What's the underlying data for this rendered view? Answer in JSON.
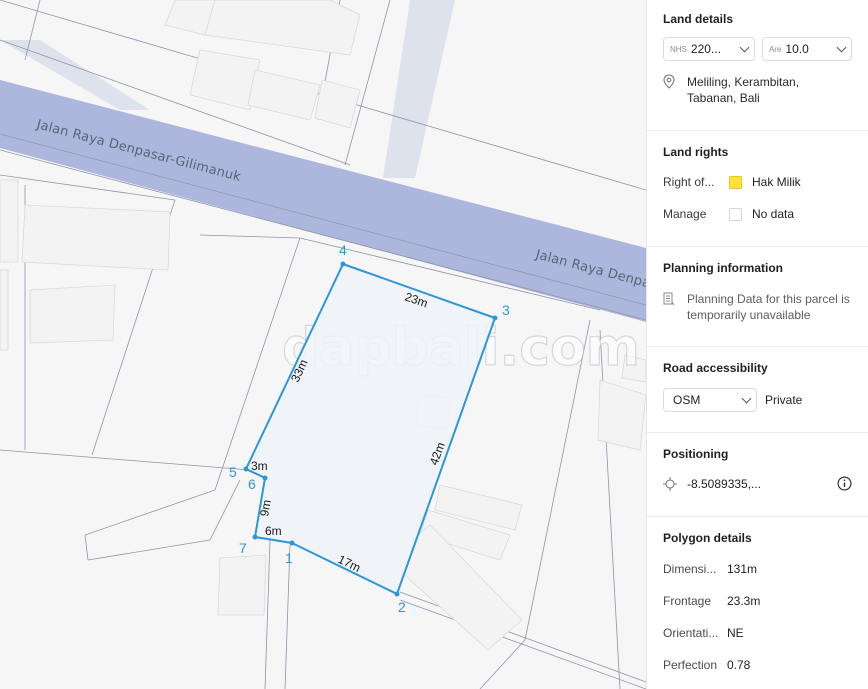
{
  "map": {
    "road_label_left": "Jalan Raya Denpasar-Gilimanuk",
    "road_label_right": "Jalan Raya Denpasar-Gilimanuk",
    "watermark": "dapbali.com",
    "vertices": [
      "1",
      "2",
      "3",
      "4",
      "5",
      "6",
      "7"
    ],
    "edges": [
      "23m",
      "33m",
      "42m",
      "3m",
      "9m",
      "6m",
      "17m"
    ]
  },
  "land_details": {
    "title": "Land details",
    "nib_prefix": "NHS",
    "nib_value": "220...",
    "area_prefix": "Are",
    "area_value": "10.0",
    "location": "Meliling, Kerambitan, Tabanan, Bali"
  },
  "land_rights": {
    "title": "Land rights",
    "right_label": "Right of...",
    "right_value": "Hak Milik",
    "right_color": "#ffe23a",
    "manage_label": "Manage",
    "manage_value": "No data"
  },
  "planning": {
    "title": "Planning information",
    "message": "Planning Data for this parcel is temporarily unavailable"
  },
  "road": {
    "title": "Road accessibility",
    "select_value": "OSM",
    "access_value": "Private"
  },
  "positioning": {
    "title": "Positioning",
    "coordinate": "-8.5089335,..."
  },
  "polygon": {
    "title": "Polygon details",
    "rows": [
      {
        "label": "Dimensi...",
        "value": "131m"
      },
      {
        "label": "Frontage",
        "value": "23.3m"
      },
      {
        "label": "Orientati...",
        "value": "NE"
      },
      {
        "label": "Perfection",
        "value": "0.78"
      }
    ]
  },
  "colors": {
    "road": "#adb6dc",
    "parcel_outline": "#2c97d8",
    "parcel_fill": "#eef2f8",
    "accent_vertex": "#2c97d8"
  }
}
